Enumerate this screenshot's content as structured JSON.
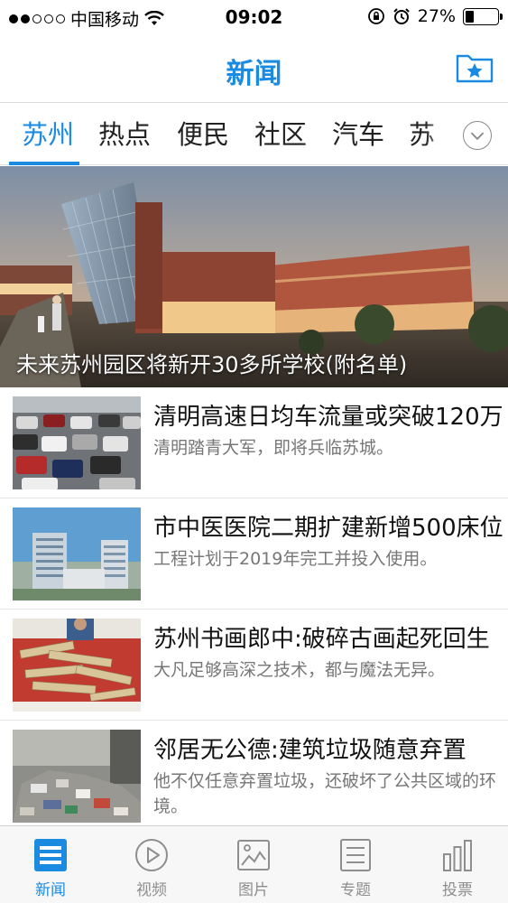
{
  "status_bar": {
    "carrier": "中国移动",
    "time": "09:02",
    "battery": "27%",
    "battery_level": 0.27,
    "icons": [
      "signal-dots",
      "wifi-icon",
      "orientation-lock-icon",
      "alarm-icon",
      "battery-icon"
    ]
  },
  "nav": {
    "title": "新闻",
    "favorites_icon": "folder-star-icon"
  },
  "tabs": [
    {
      "label": "苏州",
      "active": true
    },
    {
      "label": "热点",
      "active": false
    },
    {
      "label": "便民",
      "active": false
    },
    {
      "label": "社区",
      "active": false
    },
    {
      "label": "汽车",
      "active": false
    },
    {
      "label": "苏",
      "active": false
    }
  ],
  "more_tabs_icon": "chevron-down-circle-icon",
  "hero": {
    "caption": "未来苏州园区将新开30多所学校(附名单)"
  },
  "news": [
    {
      "title": "清明高速日均车流量或突破120万",
      "summary": "清明踏青大军，即将兵临苏城。"
    },
    {
      "title": "市中医医院二期扩建新增500床位",
      "summary": "工程计划于2019年完工并投入使用。"
    },
    {
      "title": "苏州书画郎中:破碎古画起死回生",
      "summary": "大凡足够高深之技术，都与魔法无异。"
    },
    {
      "title": "邻居无公德:建筑垃圾随意弃置",
      "summary": "他不仅任意弃置垃圾，还破坏了公共区域的环境。"
    }
  ],
  "tab_bar": [
    {
      "label": "新闻",
      "icon": "news-icon",
      "active": true
    },
    {
      "label": "视频",
      "icon": "play-icon",
      "active": false
    },
    {
      "label": "图片",
      "icon": "picture-icon",
      "active": false
    },
    {
      "label": "专题",
      "icon": "topic-list-icon",
      "active": false
    },
    {
      "label": "投票",
      "icon": "bar-chart-icon",
      "active": false
    }
  ],
  "colors": {
    "accent": "#1a8be0",
    "text": "#111111",
    "summary": "#777777",
    "tab_inactive": "#8e8e8e"
  }
}
